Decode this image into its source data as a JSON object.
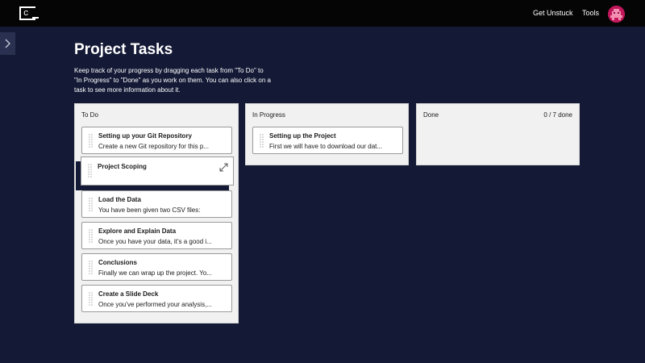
{
  "header": {
    "logo_text": "c",
    "nav": [
      "Get Unstuck",
      "Tools"
    ]
  },
  "page": {
    "title": "Project Tasks",
    "intro": "Keep track of your progress by dragging each task from \"To Do\" to \"In Progress\" to \"Done\" as you work on them. You can also click on a task to see more information about it."
  },
  "board": {
    "todo": {
      "title": "To Do",
      "cards": [
        {
          "title": "Setting up your Git Repository",
          "desc": "Create a new Git repository for this p..."
        },
        {
          "title": "Project Scoping",
          "desc": ""
        },
        {
          "title": "Load the Data",
          "desc": "You have been given two CSV files:"
        },
        {
          "title": "Explore and Explain Data",
          "desc": "Once you have your data, it’s a good i..."
        },
        {
          "title": "Conclusions",
          "desc": "Finally we can wrap up the project. Yo..."
        },
        {
          "title": "Create a Slide Deck",
          "desc": "Once you’ve performed your analysis,..."
        }
      ]
    },
    "in_progress": {
      "title": "In Progress",
      "cards": [
        {
          "title": "Setting up the Project",
          "desc": "First we will have to download our dat..."
        }
      ]
    },
    "done": {
      "title": "Done",
      "count": "0 / 7 done"
    }
  },
  "colors": {
    "background": "#141a36",
    "topbar": "#050505",
    "avatar": "#c2185b",
    "column": "#f1f1f1"
  }
}
